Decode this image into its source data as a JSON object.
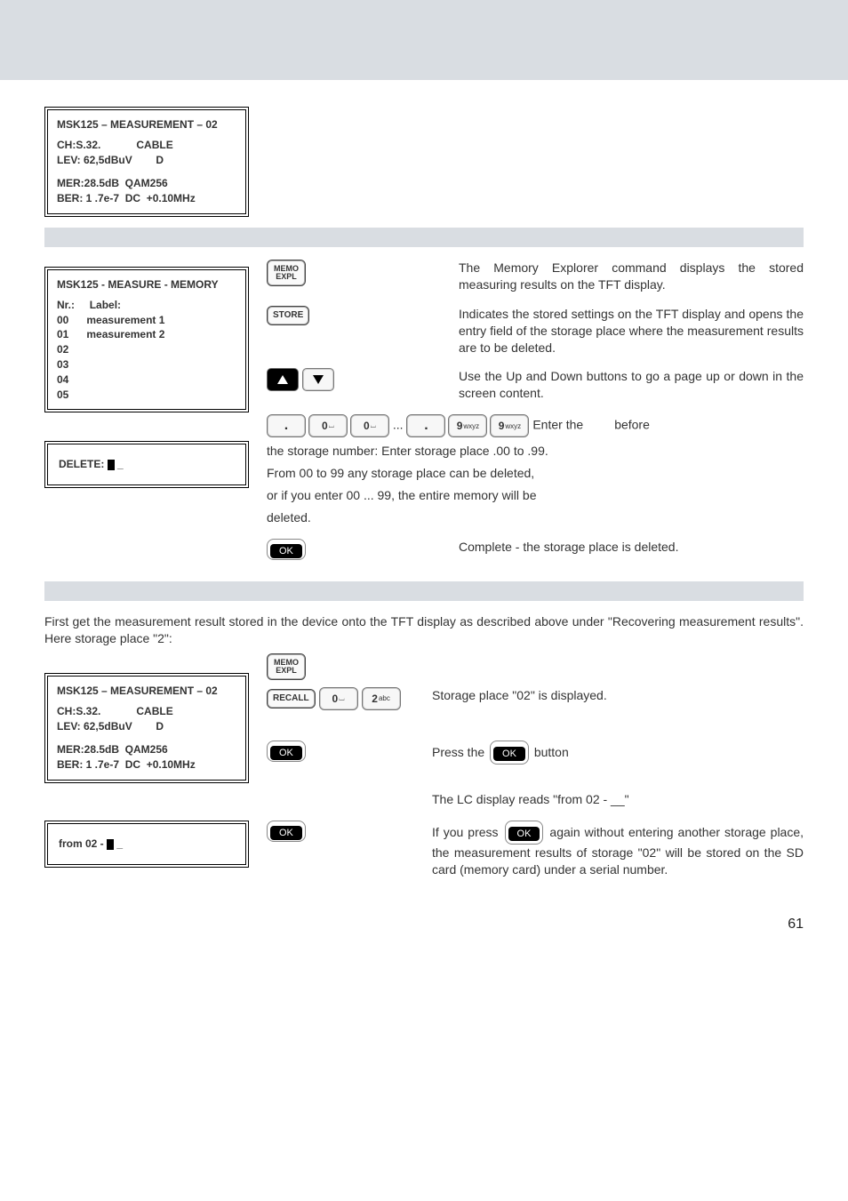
{
  "page_number": "61",
  "screen1": {
    "title": "MSK125 – MEASUREMENT – 02",
    "line1a": "CH:S.32.",
    "line1b": "CABLE",
    "line2a": "LEV: 62,5dBuV",
    "line2b": "D",
    "line3": "MER:28.5dB  QAM256",
    "line4": "BER: 1 .7e-7  DC  +0.10MHz"
  },
  "memoExpl": {
    "label_top": "MEMO",
    "label_bot": "EXPL",
    "text": "The Memory Explorer command displays the stored measuring results on the TFT display."
  },
  "store": {
    "label": "STORE",
    "text": "Indicates the stored settings on the TFT display and opens the entry field of the storage place where the measurement results are to be deleted."
  },
  "screenMemory": {
    "title": "MSK125 - MEASURE - MEMORY",
    "hdr_nr": "Nr.:",
    "hdr_label": "Label:",
    "rows": [
      {
        "nr": "00",
        "label": "measurement 1"
      },
      {
        "nr": "01",
        "label": "measurement 2"
      },
      {
        "nr": "02",
        "label": ""
      },
      {
        "nr": "03",
        "label": ""
      },
      {
        "nr": "04",
        "label": ""
      },
      {
        "nr": "05",
        "label": ""
      }
    ]
  },
  "upDown": {
    "text": "Use the Up and Down buttons to go a page up or down in the screen content."
  },
  "deleteScreen": {
    "label": "DELETE:",
    "cursor_suffix": "_"
  },
  "enter": {
    "dot": ".",
    "zero": "0",
    "space_glyph": "␣",
    "ellipsis": "...",
    "nine": "9",
    "nine_sub": "wxyz",
    "prefix": "Enter the",
    "suffix": "before",
    "line2": "the storage number: Enter storage place .00 to .99.",
    "line3": "From 00 to 99 any storage place can be deleted,",
    "line4": "or if you enter 00 ... 99, the entire memory will be",
    "line5": "deleted."
  },
  "ok1": {
    "label": "OK",
    "text": "Complete - the storage place is deleted."
  },
  "intro2": "First get the measurement result stored in the device onto the TFT display as described above under \"Recovering measurement results\". Here storage place \"2\":",
  "screen3": {
    "title": "MSK125 – MEASUREMENT – 02",
    "line1a": "CH:S.32.",
    "line1b": "CABLE",
    "line2a": "LEV: 62,5dBuV",
    "line2b": "D",
    "line3": "MER:28.5dB  QAM256",
    "line4": "BER: 1 .7e-7  DC  +0.10MHz"
  },
  "recall": {
    "label": "RECALL",
    "two": "2",
    "two_sub": "abc",
    "text": "Storage place \"02\" is displayed."
  },
  "pressOk": {
    "prefix": "Press the",
    "suffix": "button"
  },
  "fromScreen": {
    "label_prefix": "from 02 -",
    "cursor_suffix": "_"
  },
  "lcdisplay": {
    "text": "The LC display reads \"from 02 - __\""
  },
  "ok2": {
    "prefix": "If you press",
    "mid": "again without entering",
    "rest": "another storage place, the measurement results of storage \"02\" will be stored on the SD card (memory card) under a serial number."
  }
}
